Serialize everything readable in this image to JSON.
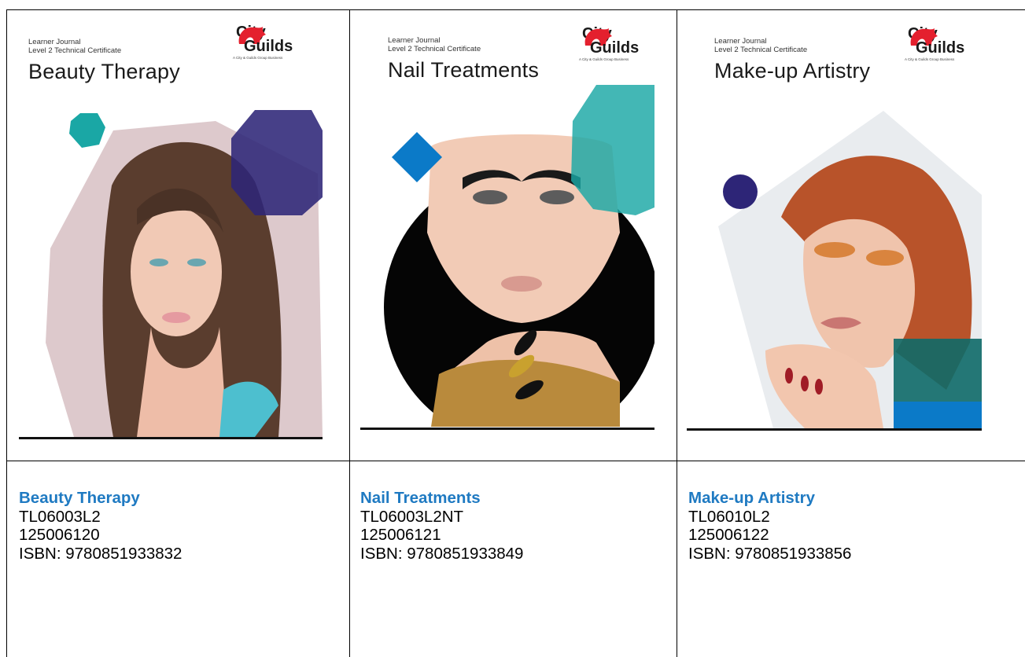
{
  "covers": [
    {
      "series_line1": "Learner Journal",
      "series_line2": "Level 2 Technical Certificate",
      "cover_title": "Beauty Therapy",
      "logo_line1": "City",
      "logo_line2": "Guilds",
      "logo_tagline": "A City & Guilds Group Business"
    },
    {
      "series_line1": "Learner Journal",
      "series_line2": "Level 2 Technical Certificate",
      "cover_title": "Nail Treatments",
      "logo_line1": "City",
      "logo_line2": "Guilds",
      "logo_tagline": "A City & Guilds Group Business"
    },
    {
      "series_line1": "Learner Journal",
      "series_line2": "Level 2 Technical Certificate",
      "cover_title": "Make-up Artistry",
      "logo_line1": "City",
      "logo_line2": "Guilds",
      "logo_tagline": "A City & Guilds Group Business"
    }
  ],
  "products": [
    {
      "title": "Beauty Therapy",
      "code": "TL06003L2",
      "number": "125006120",
      "isbn": "ISBN: 9780851933832"
    },
    {
      "title": "Nail Treatments",
      "code": "TL06003L2NT",
      "number": "125006121",
      "isbn": "ISBN: 9780851933849"
    },
    {
      "title": "Make-up Artistry",
      "code": "TL06010L2",
      "number": "125006122",
      "isbn": "ISBN: 9780851933856"
    }
  ],
  "colors": {
    "title_blue": "#1f7ac2",
    "teal": "#1aa7a5",
    "navy": "#2d2577",
    "blue": "#0b7ac8",
    "logo_red": "#e4202e"
  },
  "icons": [
    "city-guilds-lion-icon"
  ]
}
